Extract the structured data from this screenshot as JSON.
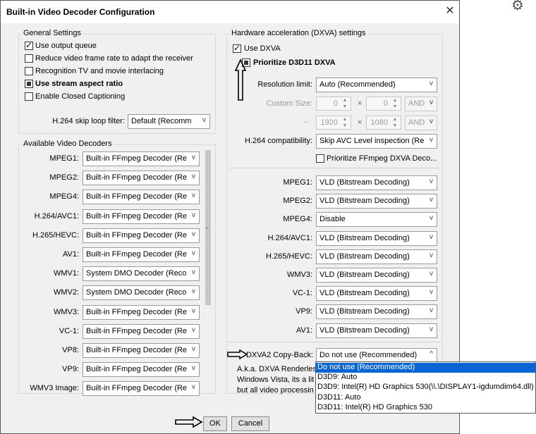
{
  "window": {
    "title": "Built-in Video Decoder Configuration",
    "close_symbol": "✕",
    "gear_symbol": "⚙"
  },
  "general": {
    "title": "General Settings",
    "items": [
      {
        "label": "Use output queue",
        "state": "checked"
      },
      {
        "label": "Reduce video frame rate to adapt the receiver",
        "state": "unchecked"
      },
      {
        "label": "Recognition TV and movie interlacing",
        "state": "unchecked"
      },
      {
        "label": "Use stream aspect ratio",
        "state": "indeterminate"
      },
      {
        "label": "Enable Closed Captioning",
        "state": "unchecked"
      }
    ],
    "skip_loop_label": "H.264 skip loop filter:",
    "skip_loop_value": "Default (Recomm"
  },
  "decoders": {
    "title": "Available Video Decoders",
    "rows": [
      {
        "label": "MPEG1:",
        "value": "Built-in FFmpeg Decoder (Re"
      },
      {
        "label": "MPEG2:",
        "value": "Built-in FFmpeg Decoder (Re"
      },
      {
        "label": "MPEG4:",
        "value": "Built-in FFmpeg Decoder (Re"
      },
      {
        "label": "H.264/AVC1:",
        "value": "Built-in FFmpeg Decoder (Re"
      },
      {
        "label": "H.265/HEVC:",
        "value": "Built-in FFmpeg Decoder (Re"
      },
      {
        "label": "AV1:",
        "value": "Built-in FFmpeg Decoder (Re"
      },
      {
        "label": "WMV1:",
        "value": "System DMO Decoder (Reco"
      },
      {
        "label": "WMV2:",
        "value": "System DMO Decoder (Reco"
      },
      {
        "label": "WMV3:",
        "value": "Built-in FFmpeg Decoder (Re"
      },
      {
        "label": "VC-1:",
        "value": "Built-in FFmpeg Decoder (Re"
      },
      {
        "label": "VP8:",
        "value": "Built-in FFmpeg Decoder (Re"
      },
      {
        "label": "VP9:",
        "value": "Built-in FFmpeg Decoder (Re"
      },
      {
        "label": "WMV3 Image:",
        "value": "Built-in FFmpeg Decoder (Re"
      }
    ]
  },
  "hw": {
    "title": "Hardware acceleration (DXVA) settings",
    "use_dxva": "Use DXVA",
    "prioritize_d3d11": "Prioritize D3D11 DXVA",
    "resolution_label": "Resolution limit:",
    "resolution_value": "Auto (Recommended)",
    "custom_size_label": "Custom Size:",
    "spin1": "0",
    "spin2": "0",
    "spin3": "1920",
    "spin4": "1080",
    "times": "×",
    "tilde": "~",
    "and1": "AND",
    "and2": "AND",
    "h264compat_label": "H.264 compatibility:",
    "h264compat_value": "Skip AVC Level inspection (Re",
    "prioritize_ffmpeg": "Prioritize FFmpeg DXVA Deco...",
    "rows": [
      {
        "label": "MPEG1:",
        "value": "VLD (Bitstream Decoding)"
      },
      {
        "label": "MPEG2:",
        "value": "VLD (Bitstream Decoding)"
      },
      {
        "label": "MPEG4:",
        "value": "Disable"
      },
      {
        "label": "H.264/AVC1:",
        "value": "VLD (Bitstream Decoding)"
      },
      {
        "label": "H.265/HEVC:",
        "value": "VLD (Bitstream Decoding)"
      },
      {
        "label": "WMV3:",
        "value": "VLD (Bitstream Decoding)"
      },
      {
        "label": "VC-1:",
        "value": "VLD (Bitstream Decoding)"
      },
      {
        "label": "VP9:",
        "value": "VLD (Bitstream Decoding)"
      },
      {
        "label": "AV1:",
        "value": "VLD (Bitstream Decoding)"
      }
    ],
    "copyback_label": "DXVA2 Copy-Back:",
    "copyback_value": "Do not use (Recommended)",
    "desc_lines": [
      "A.k.a. DXVA Renderless",
      "Windows Vista, its a lit",
      "but all video processin"
    ]
  },
  "dropdown": {
    "options": [
      "Do not use (Recommended)",
      "D3D9: Auto",
      "D3D9: Intel(R) HD Graphics 530(\\\\.\\DISPLAY1-igdumdim64.dll)",
      "D3D11: Auto",
      "D3D11: Intel(R) HD Graphics 530"
    ],
    "selected_index": 0
  },
  "buttons": {
    "ok": "OK",
    "cancel": "Cancel"
  },
  "glyphs": {
    "down_arrow": "v",
    "up_arrow": "^",
    "spin_up": "▲",
    "spin_down": "▼",
    "scroll_grip": "≡"
  }
}
